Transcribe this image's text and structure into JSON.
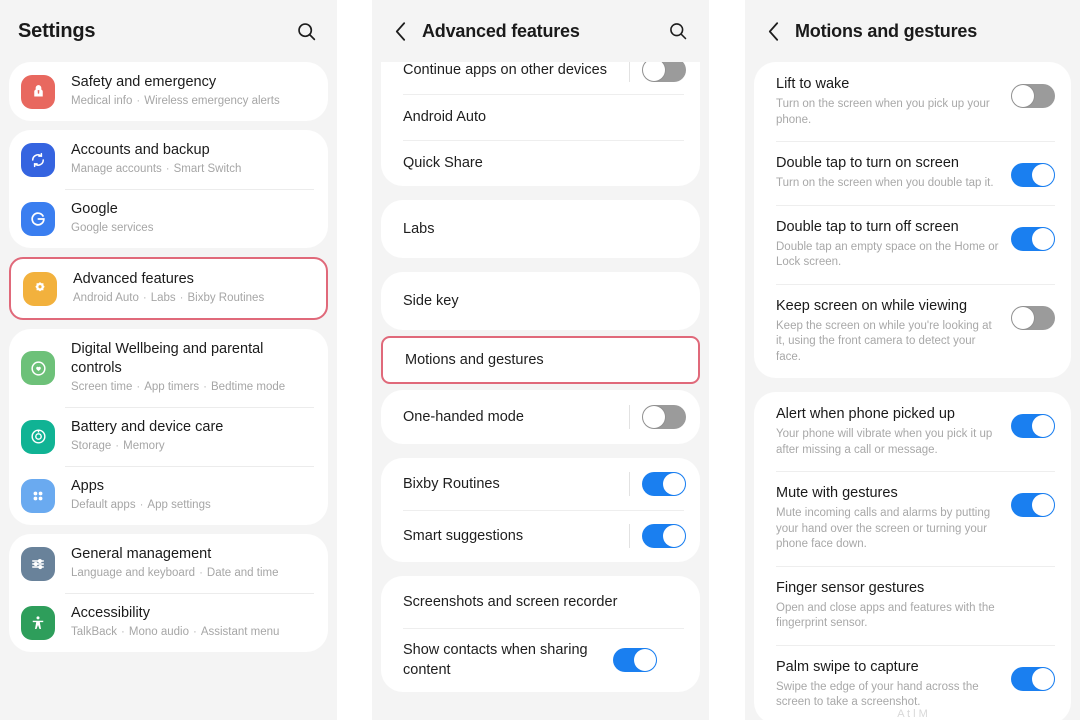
{
  "colors": {
    "accent_blue": "#1a7ff0",
    "highlight_red": "#e0697a",
    "panel_bg": "#f4f4f4",
    "card_bg": "#ffffff",
    "toggle_off": "#9b9b9b"
  },
  "panel1": {
    "header": {
      "title": "Settings",
      "search_icon": "search-icon"
    },
    "groups": [
      {
        "items": [
          {
            "title": "Safety and emergency",
            "subtitle": [
              "Medical info",
              "Wireless emergency alerts"
            ],
            "icon": "emergency-icon",
            "icon_color": "#e8685f"
          }
        ]
      },
      {
        "items": [
          {
            "title": "Accounts and backup",
            "subtitle": [
              "Manage accounts",
              "Smart Switch"
            ],
            "icon": "sync-icon",
            "icon_color": "#3564e0"
          },
          {
            "title": "Google",
            "subtitle": [
              "Google services"
            ],
            "icon": "google-icon",
            "icon_color": "#3a7ef0"
          }
        ]
      },
      {
        "highlighted": true,
        "items": [
          {
            "title": "Advanced features",
            "subtitle": [
              "Android Auto",
              "Labs",
              "Bixby Routines"
            ],
            "icon": "advanced-features-icon",
            "icon_color": "#f2b13d"
          }
        ]
      },
      {
        "items": [
          {
            "title": "Digital Wellbeing and parental controls",
            "subtitle": [
              "Screen time",
              "App timers",
              "Bedtime mode"
            ],
            "icon": "wellbeing-icon",
            "icon_color": "#6dc179"
          },
          {
            "title": "Battery and device care",
            "subtitle": [
              "Storage",
              "Memory"
            ],
            "icon": "device-care-icon",
            "icon_color": "#10b394"
          },
          {
            "title": "Apps",
            "subtitle": [
              "Default apps",
              "App settings"
            ],
            "icon": "apps-icon",
            "icon_color": "#6aaaf0"
          }
        ]
      },
      {
        "items": [
          {
            "title": "General management",
            "subtitle": [
              "Language and keyboard",
              "Date and time"
            ],
            "icon": "sliders-icon",
            "icon_color": "#69829a"
          },
          {
            "title": "Accessibility",
            "subtitle": [
              "TalkBack",
              "Mono audio",
              "Assistant menu"
            ],
            "icon": "accessibility-icon",
            "icon_color": "#2e9e5b"
          }
        ]
      }
    ]
  },
  "panel2": {
    "header": {
      "title": "Advanced features",
      "back_icon": "back-arrow-icon",
      "search_icon": "search-icon"
    },
    "groups": [
      {
        "partial_top": true,
        "items": [
          {
            "label": "Continue apps on other devices",
            "toggle": "off",
            "divider": true
          },
          {
            "label": "Android Auto",
            "toggle": null
          },
          {
            "label": "Quick Share",
            "toggle": null
          }
        ]
      },
      {
        "items": [
          {
            "label": "Labs",
            "toggle": null
          }
        ]
      },
      {
        "items": [
          {
            "label": "Side key",
            "toggle": null
          }
        ]
      },
      {
        "highlighted": true,
        "items": [
          {
            "label": "Motions and gestures",
            "toggle": null
          }
        ]
      },
      {
        "items": [
          {
            "label": "One-handed mode",
            "toggle": "off"
          }
        ]
      },
      {
        "items": [
          {
            "label": "Bixby Routines",
            "toggle": "on"
          },
          {
            "label": "Smart suggestions",
            "toggle": "on"
          }
        ]
      },
      {
        "items": [
          {
            "label": "Screenshots and screen recorder",
            "toggle": null
          },
          {
            "label": "Show contacts when sharing content",
            "toggle": "on"
          }
        ]
      }
    ]
  },
  "panel3": {
    "header": {
      "title": "Motions and gestures",
      "back_icon": "back-arrow-icon"
    },
    "groups": [
      {
        "items": [
          {
            "title": "Lift to wake",
            "subtitle": "Turn on the screen when you pick up your phone.",
            "toggle": "off"
          },
          {
            "title": "Double tap to turn on screen",
            "subtitle": "Turn on the screen when you double tap it.",
            "toggle": "on"
          },
          {
            "title": "Double tap to turn off screen",
            "subtitle": "Double tap an empty space on the Home or Lock screen.",
            "toggle": "on"
          },
          {
            "title": "Keep screen on while viewing",
            "subtitle": "Keep the screen on while you're looking at it, using the front camera to detect your face.",
            "toggle": "off"
          }
        ]
      },
      {
        "items": [
          {
            "title": "Alert when phone picked up",
            "subtitle": "Your phone will vibrate when you pick it up after missing a call or message.",
            "toggle": "on"
          },
          {
            "title": "Mute with gestures",
            "subtitle": "Mute incoming calls and alarms by putting your hand over the screen or turning your phone face down.",
            "toggle": "on"
          },
          {
            "title": "Finger sensor gestures",
            "subtitle": "Open and close apps and features with the fingerprint sensor.",
            "toggle": null
          },
          {
            "title": "Palm swipe to capture",
            "subtitle": "Swipe the edge of your hand across the screen to take a screenshot.",
            "toggle": "on"
          }
        ]
      }
    ],
    "cut_off_text": "A  t    l  M"
  }
}
